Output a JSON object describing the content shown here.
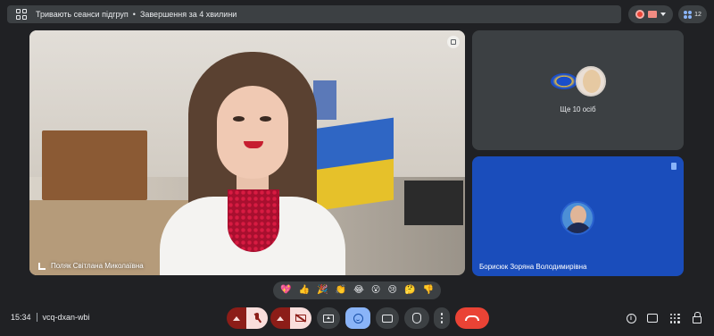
{
  "banner": {
    "status": "Тривають сеанси підгруп",
    "separator": "•",
    "countdown": "Завершення за 4 хвилини"
  },
  "top_right": {
    "people_count": "12"
  },
  "main_tile": {
    "speaker_name": "Поляк Світлана Миколаївна"
  },
  "others_tile": {
    "label": "Ще 10 осіб"
  },
  "self_tile": {
    "name": "Борисюк Зоряна Володимирівна"
  },
  "reactions": [
    "💖",
    "👍",
    "🎉",
    "👏",
    "😂",
    "😮",
    "😢",
    "🤔",
    "👎"
  ],
  "footer": {
    "time": "15:34",
    "meeting_code": "vcq-dxan-wbi"
  },
  "colors": {
    "background": "#202124",
    "hangup": "#ea4335",
    "reaction_active": "#8ab4f8",
    "muted_toggle": "#f9dedc",
    "self_tile": "#1a4dbb"
  }
}
